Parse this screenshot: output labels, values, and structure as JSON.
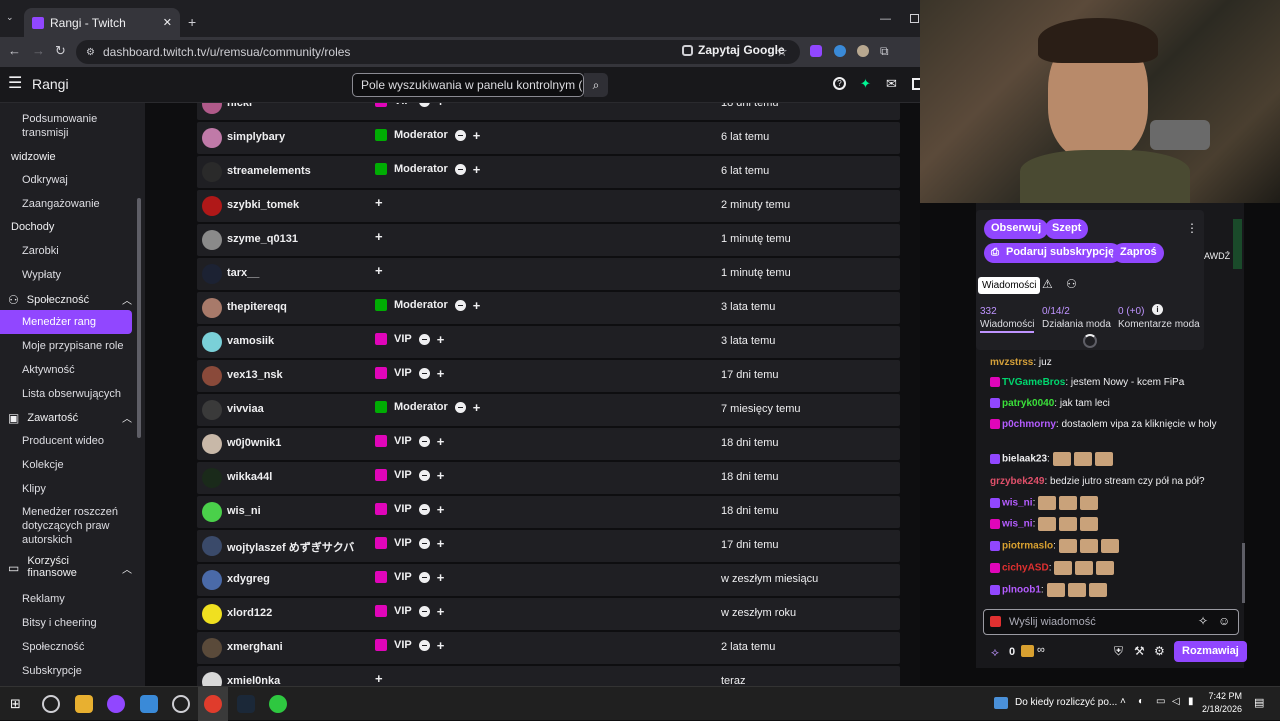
{
  "browser": {
    "tab_title": "Rangi - Twitch",
    "url": "dashboard.twitch.tv/u/remsua/community/roles",
    "google_chip": "Zapytaj Google"
  },
  "header": {
    "title": "Rangi",
    "search_placeholder": "Pole wyszukiwania w panelu kontrolnym (Ctrl+/)"
  },
  "sidebar": {
    "items": [
      {
        "label": "Podsumowanie transmisji",
        "kind": "sub"
      },
      {
        "label": "widzowie",
        "kind": "head"
      },
      {
        "label": "Odkrywaj",
        "kind": "sub"
      },
      {
        "label": "Zaangażowanie",
        "kind": "sub"
      },
      {
        "label": "Dochody",
        "kind": "head"
      },
      {
        "label": "Zarobki",
        "kind": "sub"
      },
      {
        "label": "Wypłaty",
        "kind": "sub"
      },
      {
        "label": "Społeczność",
        "kind": "section"
      },
      {
        "label": "Menedżer rang",
        "kind": "active"
      },
      {
        "label": "Moje przypisane role",
        "kind": "sub"
      },
      {
        "label": "Aktywność",
        "kind": "sub"
      },
      {
        "label": "Lista obserwujących",
        "kind": "sub"
      },
      {
        "label": "Zawartość",
        "kind": "section"
      },
      {
        "label": "Producent wideo",
        "kind": "sub"
      },
      {
        "label": "Kolekcje",
        "kind": "sub"
      },
      {
        "label": "Klipy",
        "kind": "sub"
      },
      {
        "label": "Menedżer roszczeń dotyczących praw autorskich",
        "kind": "sub"
      },
      {
        "label": "Korzyści finansowe",
        "kind": "section"
      },
      {
        "label": "Reklamy",
        "kind": "sub"
      },
      {
        "label": "Bitsy i cheering",
        "kind": "sub"
      },
      {
        "label": "Społeczność",
        "kind": "sub"
      },
      {
        "label": "Subskrypcje",
        "kind": "sub"
      }
    ]
  },
  "roles_table": {
    "rows": [
      {
        "user": "nicki",
        "role": "VIP",
        "when": "18 dni temu",
        "avatar": "#b05a8a"
      },
      {
        "user": "simplybary",
        "role": "Moderator",
        "when": "6 lat temu",
        "avatar": "#c07aa8"
      },
      {
        "user": "streamelements",
        "role": "Moderator",
        "when": "6 lat temu",
        "avatar": "#2a2a2a"
      },
      {
        "user": "szybki_tomek",
        "role": "",
        "when": "2 minuty temu",
        "avatar": "#b01818"
      },
      {
        "user": "szyme_q0131",
        "role": "",
        "when": "1 minutę temu",
        "avatar": "#8a8a8a"
      },
      {
        "user": "tarx__",
        "role": "",
        "when": "1 minutę temu",
        "avatar": "#1c2233"
      },
      {
        "user": "thepitereqq",
        "role": "Moderator",
        "when": "3 lata temu",
        "avatar": "#a87a6a"
      },
      {
        "user": "vamosiik",
        "role": "VIP",
        "when": "3 lata temu",
        "avatar": "#7ad0d8"
      },
      {
        "user": "vex13_nsk",
        "role": "VIP",
        "when": "17 dni temu",
        "avatar": "#8a4a3a"
      },
      {
        "user": "vivviaa",
        "role": "Moderator",
        "when": "7 miesięcy temu",
        "avatar": "#3a3a3a"
      },
      {
        "user": "w0j0wnik1",
        "role": "VIP",
        "when": "18 dni temu",
        "avatar": "#c8b8a8"
      },
      {
        "user": "wikka44l",
        "role": "VIP",
        "when": "18 dni temu",
        "avatar": "#1a2a1a"
      },
      {
        "user": "wis_ni",
        "role": "VIP",
        "when": "18 dni temu",
        "avatar": "#4ad04a"
      },
      {
        "user": "wojtylaszef めずぎサクバ",
        "role": "VIP",
        "when": "17 dni temu",
        "avatar": "#3a4a6a"
      },
      {
        "user": "xdygreg",
        "role": "VIP",
        "when": "w zeszłym miesiącu",
        "avatar": "#4a6aa8"
      },
      {
        "user": "xlord122",
        "role": "VIP",
        "when": "w zeszłym roku",
        "avatar": "#f0e020"
      },
      {
        "user": "xmerghani",
        "role": "VIP",
        "when": "2 lata temu",
        "avatar": "#5a4a3a"
      },
      {
        "user": "xmiel0nka",
        "role": "",
        "when": "teraz",
        "avatar": "#d8d8d8"
      }
    ]
  },
  "colors": {
    "accent": "#9147ff",
    "vip": "#e005b9",
    "moderator": "#00ad03"
  },
  "chat": {
    "buttons": {
      "follow": "Obserwuj",
      "whisper": "Szept",
      "gift": "Podaruj subskrypcję",
      "invite": "Zaproś"
    },
    "tooltip": "Wiadomości",
    "stats": [
      {
        "value": "332",
        "label": "Wiadomości"
      },
      {
        "value": "0/14/2",
        "label": "Działania moda"
      },
      {
        "value": "0 (+0)",
        "label": "Komentarze moda"
      }
    ],
    "overlay_text": "AWDŹ",
    "messages": [
      {
        "user": "mvzstrss",
        "color": "#d4a03a",
        "text": ": juz"
      },
      {
        "user": "TVGameBros",
        "color": "#00d66e",
        "text": ": jestem Nowy - kcem FiPa"
      },
      {
        "user": "patryk0040",
        "color": "#3ae03a",
        "text": ": jak tam leci"
      },
      {
        "user": "p0chmorny",
        "color": "#b45cff",
        "text": ": dostaolem vipa za kliknięcie w holy"
      },
      {
        "user": "bielaak23",
        "color": "#efeff1",
        "text": ":"
      },
      {
        "user": "grzybek249",
        "color": "#e0506a",
        "text": ": bedzie jutro stream czy pół na pół?"
      },
      {
        "user": "wis_ni",
        "color": "#b45cff",
        "text": ":"
      },
      {
        "user": "wis_ni",
        "color": "#b45cff",
        "text": ":"
      },
      {
        "user": "piotrmaslo",
        "color": "#d8a030",
        "text": ":"
      },
      {
        "user": "cichyASD",
        "color": "#e03030",
        "text": ":"
      },
      {
        "user": "plnoob1",
        "color": "#b45cff",
        "text": ":"
      }
    ],
    "input_placeholder": "Wyślij wiadomość",
    "points": "0",
    "infinity": "∞",
    "chat_button": "Rozmawiaj"
  },
  "taskbar": {
    "notification": "Do kiedy rozliczyć po...",
    "time": "7:42 PM",
    "date": "2/18/2026"
  }
}
